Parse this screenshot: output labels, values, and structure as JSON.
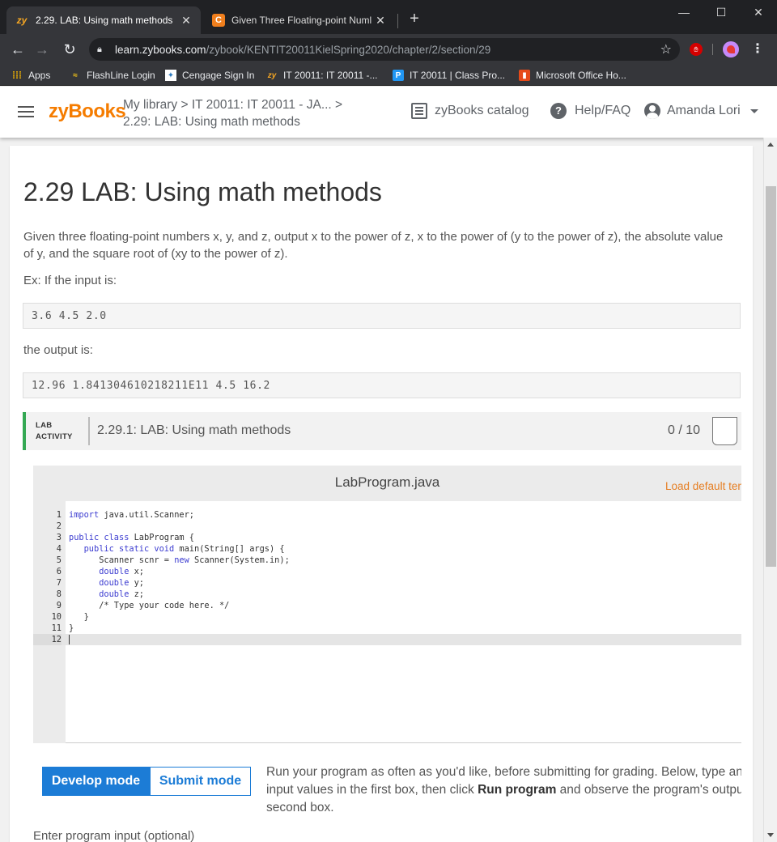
{
  "browser": {
    "tabs": [
      {
        "title": "2.29. LAB: Using math methods",
        "icon": "zybooks-favicon",
        "close": "✕"
      },
      {
        "title": "Given Three Floating-point Numl",
        "icon": "chegg-favicon",
        "close": "✕"
      }
    ],
    "new_tab": "+",
    "window_controls": {
      "minimize": "—",
      "maximize": "☐",
      "close": "✕"
    },
    "url_host": "learn.zybooks.com",
    "url_path": "/zybook/KENTIT20011KielSpring2020/chapter/2/section/29",
    "bookmarks": [
      {
        "label": "Apps",
        "icon": "apps-grid-icon"
      },
      {
        "label": "FlashLine Login",
        "icon": "flashline-icon"
      },
      {
        "label": "Cengage Sign In",
        "icon": "cengage-icon"
      },
      {
        "label": "IT 20011: IT 20011 -...",
        "icon": "zybooks-favicon"
      },
      {
        "label": "IT 20011 | Class Pro...",
        "icon": "p-favicon"
      },
      {
        "label": "Microsoft Office Ho...",
        "icon": "office-icon"
      }
    ]
  },
  "header": {
    "logo": "zyBooks",
    "breadcrumb_link": "My library > IT 20011: IT 20011 - JA...",
    "breadcrumb_chevron": ">",
    "breadcrumb_current": "2.29: LAB: Using math methods",
    "catalog": "zyBooks catalog",
    "help": "Help/FAQ",
    "user": "Amanda Lori"
  },
  "section": {
    "title": "2.29 LAB: Using math methods",
    "description": "Given three floating-point numbers x, y, and z, output x to the power of z, x to the power of (y to the power of z), the absolute value of y, and the square root of (xy to the power of z).",
    "example_label": "Ex: If the input is:",
    "example_input": "3.6 4.5 2.0",
    "output_label": "the output is:",
    "example_output": "12.96 1.841304610218211E11 4.5 16.2"
  },
  "lab": {
    "tag_line1": "LAB",
    "tag_line2": "ACTIVITY",
    "title": "2.29.1: LAB: Using math methods",
    "score": "0 / 10",
    "accent_color": "#34a853"
  },
  "editor": {
    "filename": "LabProgram.java",
    "load_default": "Load default template...",
    "lines": [
      {
        "n": "1",
        "code": "import java.util.Scanner;"
      },
      {
        "n": "2",
        "code": ""
      },
      {
        "n": "3",
        "code": "public class LabProgram {"
      },
      {
        "n": "4",
        "code": "   public static void main(String[] args) {"
      },
      {
        "n": "5",
        "code": "      Scanner scnr = new Scanner(System.in);"
      },
      {
        "n": "6",
        "code": "      double x;"
      },
      {
        "n": "7",
        "code": "      double y;"
      },
      {
        "n": "8",
        "code": "      double z;"
      },
      {
        "n": "9",
        "code": "      /* Type your code here. */"
      },
      {
        "n": "10",
        "code": "   }"
      },
      {
        "n": "11",
        "code": "}"
      },
      {
        "n": "12",
        "code": ""
      }
    ]
  },
  "modes": {
    "develop": "Develop mode",
    "submit": "Submit mode",
    "help_pre": "Run your program as often as you'd like, before submitting for grading. Below, type an",
    "help_mid_pre": "input values in the first box, then click ",
    "help_bold": "Run program",
    "help_mid_post": " and observe the program's output in the",
    "help_post": "second box.",
    "primary_color": "#1c7cd6"
  },
  "input_label": "Enter program input (optional)"
}
